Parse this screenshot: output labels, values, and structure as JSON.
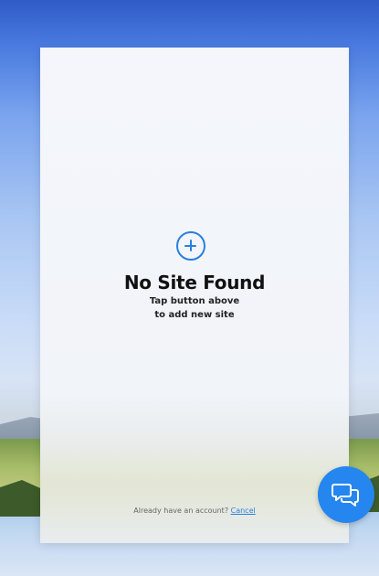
{
  "empty_state": {
    "title": "No Site Found",
    "hint_line1": "Tap button above",
    "hint_line2": "to add new site",
    "add_icon": "plus-circle-icon"
  },
  "footer": {
    "prompt": "Already have an account?",
    "link": "Cancel"
  },
  "chat": {
    "icon": "chat-bubbles-icon"
  },
  "colors": {
    "accent": "#2a7fe0",
    "chat_button": "#2486ee"
  }
}
